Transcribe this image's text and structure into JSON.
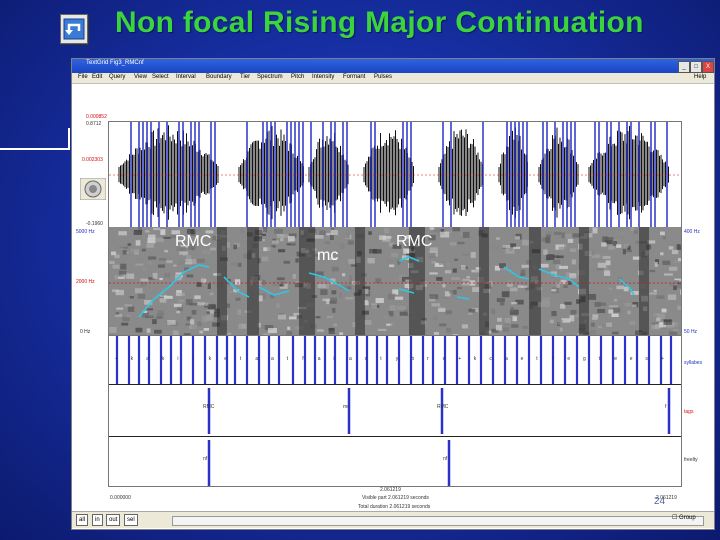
{
  "slide": {
    "title": "Non focal Rising Major Continuation",
    "number": "24",
    "back_icon": "back-arrow-icon"
  },
  "window": {
    "title": "TextGrid Fig3_RMCnf",
    "menus": [
      "File",
      "Edit",
      "Query",
      "View",
      "Select",
      "Interval",
      "Boundary",
      "Tier",
      "Spectrum",
      "Pitch",
      "Intensity",
      "Formant",
      "Pulses"
    ],
    "menu_help": "Help",
    "btn_min": "_",
    "btn_max": "□",
    "btn_close": "X"
  },
  "wave": {
    "top_red": "0.000852",
    "top_black": "0.8712",
    "mid": "0.002303",
    "bottom": "-0.1960"
  },
  "spectro": {
    "top_left": "5000 Hz",
    "mid_left": "2000 Hz",
    "bottom_left": "0 Hz",
    "top_right": "400 Hz",
    "bottom_right": "50 Hz"
  },
  "labels": {
    "rmc1": "RMC",
    "mc": "mc",
    "rmc2": "RMC"
  },
  "tiers": {
    "tier1_name": "syllabes",
    "tier2_name": "tags",
    "tier3_name": "freelty",
    "phones": [
      "+",
      "k",
      "a",
      "k",
      "i",
      "l",
      "k",
      "e",
      "t",
      "a",
      "a",
      "t",
      "f",
      "a",
      "i",
      "a",
      "s",
      "t",
      "y",
      "b",
      "r",
      "o",
      "+",
      "k",
      "c",
      "a",
      "e",
      "t",
      "y",
      "e",
      "g",
      "t",
      "e",
      "e",
      "s",
      "+"
    ],
    "tag_labels": [
      "RMC",
      "mc",
      "RMC",
      "f"
    ],
    "bottom_labels": [
      "nf",
      "nf"
    ]
  },
  "bottom": {
    "time_center": "2.061219",
    "left_time": "0.000000",
    "right_time": "2.061219",
    "visible_part": "Visible part 2.061219 seconds",
    "total_duration": "Total duration 2.061219 seconds",
    "nav": [
      "all",
      "in",
      "out",
      "sel"
    ],
    "group": "Group"
  }
}
